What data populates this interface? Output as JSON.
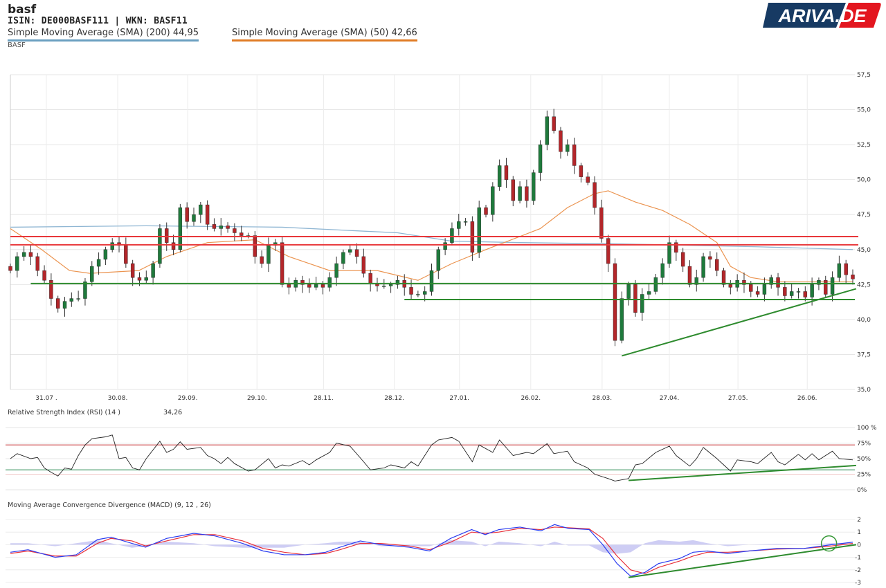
{
  "header": {
    "title": "basf",
    "ids": "ISIN: DE000BASF111  | WKN: BASF11",
    "sma200_label": "Simple Moving Average (SMA) (200) 44,95",
    "sma50_label": "Simple Moving Average (SMA) (50) 42,66",
    "instrument": "BASF",
    "logo_text": "ARIVA.DE"
  },
  "colors": {
    "up": "#1f7a3c",
    "down": "#b3262a",
    "sma200": "#8fb6d3",
    "sma50": "#eb9450",
    "resistance": "#e8373a",
    "support": "#2e8b2e",
    "macd": "#2a3cf0",
    "signal": "#e8303a",
    "hist": "#c6c4f2",
    "rsi": "#222222"
  },
  "chart_data": [
    {
      "type": "candlestick",
      "title": "BASF",
      "ylim": [
        35,
        57.5
      ],
      "yticks": [
        "35,0",
        "37,5",
        "40,0",
        "42,5",
        "45,0",
        "47,5",
        "50,0",
        "52,5",
        "55,0",
        "57,5"
      ],
      "xticks": [
        {
          "label": "31.07 .",
          "day": 5.3
        },
        {
          "label": "30.08.",
          "day": 15.8
        },
        {
          "label": "29.09.",
          "day": 26.1
        },
        {
          "label": "29.10.",
          "day": 36.3
        },
        {
          "label": "28.11.",
          "day": 46.1
        },
        {
          "label": "28.12.",
          "day": 56.5
        },
        {
          "label": "27.01.",
          "day": 66.1
        },
        {
          "label": "26.02.",
          "day": 76.6
        },
        {
          "label": "28.03.",
          "day": 87.1
        },
        {
          "label": "27.04.",
          "day": 97
        },
        {
          "label": "27.05.",
          "day": 107.1
        },
        {
          "label": "26.06.",
          "day": 117.3
        }
      ],
      "closes": [
        43.5,
        44.5,
        44.8,
        44.5,
        43.5,
        42.8,
        41.5,
        40.8,
        41.3,
        41.5,
        41.5,
        42.7,
        43.8,
        44.3,
        45.0,
        45.5,
        45.3,
        44.0,
        43.0,
        42.8,
        43.0,
        44.0,
        46.5,
        45.5,
        45.0,
        48.0,
        47.0,
        47.5,
        48.2,
        46.8,
        46.5,
        46.7,
        46.5,
        46.2,
        46.0,
        46.0,
        44.5,
        44.0,
        45.3,
        45.5,
        42.5,
        42.3,
        42.8,
        42.5,
        42.3,
        42.5,
        42.3,
        43.0,
        44.0,
        44.8,
        45.0,
        44.5,
        43.3,
        42.6,
        42.4,
        42.4,
        42.5,
        42.8,
        42.3,
        41.8,
        41.8,
        42.0,
        43.5,
        45.0,
        45.5,
        46.5,
        47.0,
        47.0,
        44.8,
        48.0,
        47.5,
        49.5,
        51.0,
        50.0,
        48.5,
        49.5,
        48.5,
        50.5,
        52.5,
        54.5,
        53.5,
        52.0,
        52.5,
        51.0,
        50.2,
        49.8,
        48.0,
        45.8,
        44.0,
        38.5,
        41.5,
        42.5,
        40.5,
        41.8,
        42.0,
        43.0,
        44.0,
        45.5,
        44.8,
        43.8,
        42.5,
        43.0,
        44.5,
        44.3,
        43.5,
        42.5,
        42.3,
        42.8,
        42.5,
        42.0,
        41.8,
        42.5,
        43.0,
        42.3,
        41.7,
        42.0,
        42.0,
        41.6,
        42.5,
        42.8,
        41.8,
        43.0,
        44.0,
        43.2,
        42.9
      ],
      "sma200": [
        [
          0,
          46.6
        ],
        [
          20,
          46.7
        ],
        [
          40,
          46.6
        ],
        [
          57,
          46.2
        ],
        [
          65,
          45.6
        ],
        [
          75,
          45.5
        ],
        [
          90,
          45.4
        ],
        [
          110,
          45.2
        ],
        [
          124,
          45.0
        ]
      ],
      "sma50": [
        [
          0,
          46.5
        ],
        [
          4.6,
          45
        ],
        [
          8.7,
          43.5
        ],
        [
          11.7,
          43.3
        ],
        [
          18.9,
          43.5
        ],
        [
          23,
          44.5
        ],
        [
          29,
          45.5
        ],
        [
          36,
          45.7
        ],
        [
          41,
          44.5
        ],
        [
          47,
          43.5
        ],
        [
          54,
          43.5
        ],
        [
          60,
          42.8
        ],
        [
          65,
          44.0
        ],
        [
          70,
          45
        ],
        [
          78,
          46.5
        ],
        [
          82,
          48
        ],
        [
          86,
          49.0
        ],
        [
          88,
          49.2
        ],
        [
          92,
          48.4
        ],
        [
          96,
          47.8
        ],
        [
          100,
          46.8
        ],
        [
          104,
          45.5
        ],
        [
          106,
          43.8
        ],
        [
          109,
          43.0
        ],
        [
          113,
          42.7
        ],
        [
          124,
          42.7
        ]
      ],
      "resistance_lines": [
        {
          "value": 45.93,
          "from": 0
        },
        {
          "value": 45.34,
          "from": 0
        }
      ],
      "support_lines": [
        {
          "value": 42.57,
          "from": 3
        },
        {
          "value": 41.43,
          "from": 58
        }
      ],
      "trendline": [
        [
          90,
          37.4
        ],
        [
          124.5,
          42.2
        ]
      ]
    },
    {
      "type": "line",
      "title": "Relative Strength Index (RSI) (14 )",
      "value_label": "34,26",
      "ylim": [
        0,
        100
      ],
      "yticks": [
        "0%",
        "25%",
        "50%",
        "75%",
        "100 %"
      ],
      "overbought": 72,
      "oversold": 32,
      "values": [
        [
          0,
          50
        ],
        [
          1,
          58
        ],
        [
          3,
          50
        ],
        [
          4,
          52
        ],
        [
          5,
          35
        ],
        [
          6,
          28
        ],
        [
          7,
          22
        ],
        [
          8,
          35
        ],
        [
          9,
          33
        ],
        [
          10,
          55
        ],
        [
          11,
          72
        ],
        [
          12,
          82
        ],
        [
          14,
          85
        ],
        [
          15,
          88
        ],
        [
          16,
          50
        ],
        [
          17,
          52
        ],
        [
          18,
          35
        ],
        [
          19,
          32
        ],
        [
          20,
          50
        ],
        [
          22,
          78
        ],
        [
          23,
          60
        ],
        [
          24,
          65
        ],
        [
          25,
          77
        ],
        [
          26,
          65
        ],
        [
          28,
          68
        ],
        [
          29,
          55
        ],
        [
          30,
          50
        ],
        [
          31,
          42
        ],
        [
          32,
          52
        ],
        [
          33,
          42
        ],
        [
          35,
          30
        ],
        [
          36,
          32
        ],
        [
          38,
          50
        ],
        [
          39,
          35
        ],
        [
          40,
          40
        ],
        [
          41,
          38
        ],
        [
          43,
          47
        ],
        [
          44,
          40
        ],
        [
          45,
          48
        ],
        [
          47,
          60
        ],
        [
          48,
          75
        ],
        [
          50,
          70
        ],
        [
          52,
          45
        ],
        [
          53,
          32
        ],
        [
          55,
          35
        ],
        [
          56,
          40
        ],
        [
          58,
          35
        ],
        [
          59,
          45
        ],
        [
          60,
          38
        ],
        [
          62,
          72
        ],
        [
          63,
          80
        ],
        [
          65,
          84
        ],
        [
          66,
          78
        ],
        [
          68,
          45
        ],
        [
          69,
          72
        ],
        [
          71,
          60
        ],
        [
          72,
          80
        ],
        [
          74,
          55
        ],
        [
          76,
          60
        ],
        [
          77,
          58
        ],
        [
          79,
          74
        ],
        [
          80,
          58
        ],
        [
          82,
          62
        ],
        [
          83,
          45
        ],
        [
          85,
          35
        ],
        [
          86,
          25
        ],
        [
          88,
          18
        ],
        [
          89,
          14
        ],
        [
          91,
          18
        ],
        [
          92,
          40
        ],
        [
          93,
          42
        ],
        [
          95,
          60
        ],
        [
          97,
          70
        ],
        [
          98,
          55
        ],
        [
          100,
          38
        ],
        [
          101,
          50
        ],
        [
          102,
          68
        ],
        [
          104,
          50
        ],
        [
          105,
          40
        ],
        [
          106,
          30
        ],
        [
          107,
          48
        ],
        [
          109,
          45
        ],
        [
          110,
          42
        ],
        [
          112,
          60
        ],
        [
          113,
          45
        ],
        [
          114,
          40
        ],
        [
          116,
          57
        ],
        [
          117,
          48
        ],
        [
          118,
          58
        ],
        [
          119,
          48
        ],
        [
          121,
          62
        ],
        [
          122,
          50
        ],
        [
          124,
          48
        ]
      ],
      "trendline": [
        [
          91,
          15
        ],
        [
          124.5,
          39
        ]
      ]
    },
    {
      "type": "line",
      "title": "Moving Average Convergence Divergence (MACD) (9, 12 , 26)",
      "ylim": [
        -3,
        2
      ],
      "yticks": [
        "-3",
        "-2",
        "-1",
        "0",
        "1",
        "2"
      ],
      "macd": [
        [
          0,
          -0.6
        ],
        [
          2.6,
          -0.4
        ],
        [
          6.6,
          -1.0
        ],
        [
          9.7,
          -0.8
        ],
        [
          12.8,
          0.4
        ],
        [
          14.8,
          0.6
        ],
        [
          17.9,
          0.1
        ],
        [
          19.9,
          -0.2
        ],
        [
          23,
          0.5
        ],
        [
          27,
          0.9
        ],
        [
          30.1,
          0.7
        ],
        [
          34.2,
          0.1
        ],
        [
          37.2,
          -0.5
        ],
        [
          40.3,
          -0.8
        ],
        [
          43.4,
          -0.8
        ],
        [
          46.4,
          -0.6
        ],
        [
          48.5,
          -0.2
        ],
        [
          51.5,
          0.3
        ],
        [
          54.6,
          0.0
        ],
        [
          58.7,
          -0.2
        ],
        [
          61.7,
          -0.5
        ],
        [
          64.8,
          0.5
        ],
        [
          67.9,
          1.2
        ],
        [
          69.9,
          0.8
        ],
        [
          71.9,
          1.2
        ],
        [
          75,
          1.4
        ],
        [
          78.1,
          1.1
        ],
        [
          80.1,
          1.6
        ],
        [
          82.1,
          1.3
        ],
        [
          85.2,
          1.2
        ],
        [
          87.2,
          0.0
        ],
        [
          89.3,
          -1.5
        ],
        [
          91.3,
          -2.5
        ],
        [
          93.4,
          -2.2
        ],
        [
          95.4,
          -1.5
        ],
        [
          98.5,
          -1.1
        ],
        [
          100.5,
          -0.6
        ],
        [
          102.6,
          -0.5
        ],
        [
          105.6,
          -0.7
        ],
        [
          108.7,
          -0.5
        ],
        [
          112.8,
          -0.3
        ],
        [
          116.8,
          -0.3
        ],
        [
          120.9,
          0.0
        ],
        [
          124,
          0.2
        ]
      ],
      "signal": [
        -0.7,
        -0.5,
        -0.9,
        -0.9,
        0.1,
        0.5,
        0.3,
        -0.1,
        0.3,
        0.8,
        0.8,
        0.3,
        -0.3,
        -0.6,
        -0.8,
        -0.7,
        -0.4,
        0.1,
        0.1,
        -0.1,
        -0.4,
        0.2,
        1.0,
        0.9,
        1.0,
        1.3,
        1.2,
        1.4,
        1.35,
        1.25,
        0.5,
        -0.9,
        -2.0,
        -2.3,
        -1.8,
        -1.3,
        -0.9,
        -0.6,
        -0.6,
        -0.5,
        -0.35,
        -0.3,
        -0.1,
        0.1
      ],
      "trendline": [
        [
          91,
          -2.6
        ],
        [
          124.5,
          0
        ]
      ],
      "highlight": [
        120.5,
        0.1
      ]
    }
  ]
}
